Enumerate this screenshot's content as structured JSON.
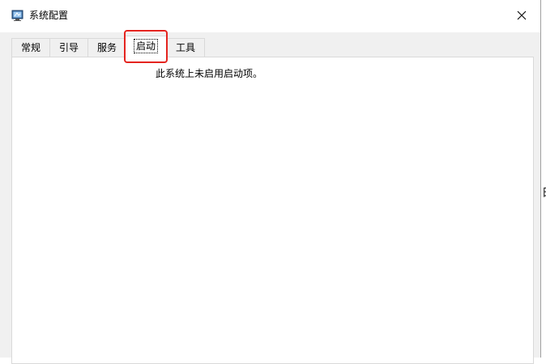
{
  "window": {
    "title": "系统配置",
    "icon": "msconfig-app-icon",
    "close_icon": "close-icon"
  },
  "tabs": [
    {
      "label": "常规",
      "active": false
    },
    {
      "label": "引导",
      "active": false
    },
    {
      "label": "服务",
      "active": false
    },
    {
      "label": "启动",
      "active": true
    },
    {
      "label": "工具",
      "active": false
    }
  ],
  "startup_pane": {
    "message": "此系统上未启用启动项。"
  },
  "annotation": {
    "highlight_color": "#e4241f",
    "highlight_target": "启动"
  },
  "background": {
    "fragment_text": "白"
  }
}
